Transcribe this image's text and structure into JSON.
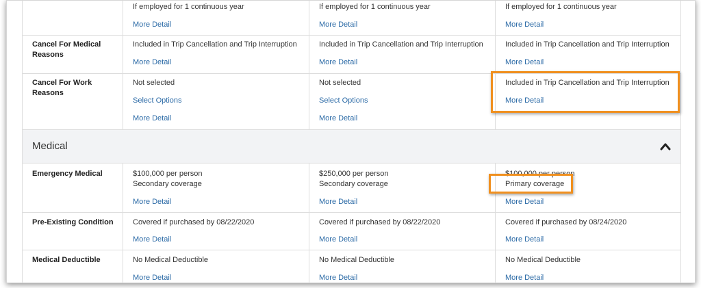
{
  "accent_link_color": "#2b6aa6",
  "highlight_color": "#f0901f",
  "top_row": {
    "col1_text": "If employed for 1 continuous year",
    "col2_text": "If employed for 1 continuous year",
    "col3_text": "If employed for 1 continuous year",
    "more_detail": "More Detail"
  },
  "cancel_medical": {
    "label": "Cancel For Medical Reasons",
    "col1_text": "Included in Trip Cancellation and Trip Interruption",
    "col2_text": "Included in Trip Cancellation and Trip Interruption",
    "col3_text": "Included in Trip Cancellation and Trip Interruption",
    "more_detail": "More Detail"
  },
  "cancel_work": {
    "label": "Cancel For Work Reasons",
    "col1_text": "Not selected",
    "col1_select": "Select Options",
    "col2_text": "Not selected",
    "col2_select": "Select Options",
    "col3_text": "Included in Trip Cancellation and Trip Interruption",
    "more_detail": "More Detail"
  },
  "section": {
    "title": "Medical",
    "toggle_icon": "chevron-up-icon"
  },
  "emergency_medical": {
    "label": "Emergency Medical",
    "col1_line1": "$100,000 per person",
    "col1_line2": "Secondary coverage",
    "col2_line1": "$250,000 per person",
    "col2_line2": "Secondary coverage",
    "col3_line1": "$100,000 per person",
    "col3_line2": "Primary coverage",
    "more_detail": "More Detail"
  },
  "pre_existing": {
    "label": "Pre-Existing Condition",
    "col1_text": "Covered if purchased by 08/22/2020",
    "col2_text": "Covered if purchased by 08/22/2020",
    "col3_text": "Covered if purchased by 08/24/2020",
    "more_detail": "More Detail"
  },
  "medical_deductible": {
    "label": "Medical Deductible",
    "col1_text": "No Medical Deductible",
    "col2_text": "No Medical Deductible",
    "col3_text": "No Medical Deductible",
    "more_detail": "More Detail"
  }
}
